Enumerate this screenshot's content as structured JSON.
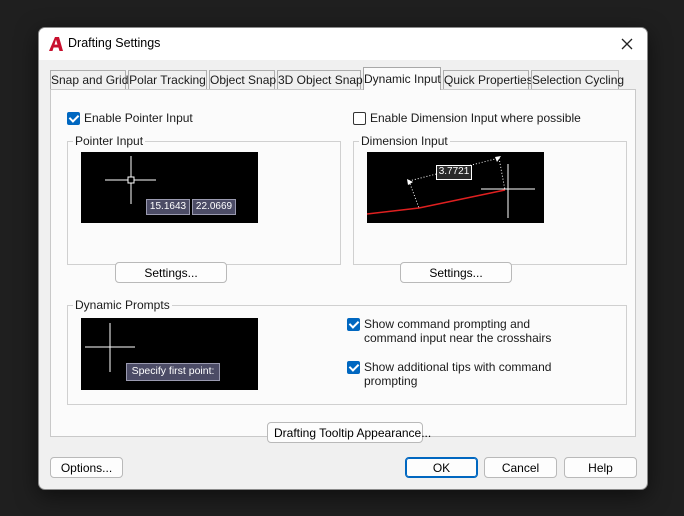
{
  "window": {
    "title": "Drafting Settings"
  },
  "tabs": [
    {
      "label": "Snap and Grid"
    },
    {
      "label": "Polar Tracking"
    },
    {
      "label": "Object Snap"
    },
    {
      "label": "3D Object Snap"
    },
    {
      "label": "Dynamic Input",
      "active": true
    },
    {
      "label": "Quick Properties"
    },
    {
      "label": "Selection Cycling"
    }
  ],
  "pointer": {
    "enable_label": "Enable Pointer Input",
    "enable_checked": true,
    "group_title": "Pointer Input",
    "coord_x": "15.1643",
    "coord_y": "22.0669",
    "settings_label": "Settings..."
  },
  "dimension": {
    "enable_label": "Enable Dimension Input where possible",
    "enable_checked": false,
    "group_title": "Dimension Input",
    "value": "3.7721",
    "settings_label": "Settings..."
  },
  "prompts": {
    "group_title": "Dynamic Prompts",
    "tooltip_text": "Specify first point:",
    "option1_line1": "Show command prompting and",
    "option1_line2": "command input near the crosshairs",
    "option1_checked": true,
    "option2_line1": "Show additional tips with command",
    "option2_line2": "prompting",
    "option2_checked": true
  },
  "tooltip_appearance_label": "Drafting Tooltip Appearance...",
  "footer": {
    "options_label": "Options...",
    "ok_label": "OK",
    "cancel_label": "Cancel",
    "help_label": "Help"
  },
  "colors": {
    "accent": "#0067c0",
    "preview_bg": "#000000",
    "dimension_line": "#e02020",
    "app_icon": "#c8102e"
  },
  "icons": {
    "app": "autocad-a-icon",
    "close": "close-icon"
  }
}
